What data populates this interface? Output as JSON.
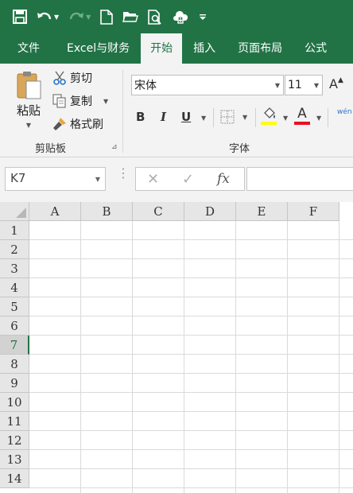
{
  "quick_access": {
    "save_icon": "save-icon",
    "undo_icon": "undo-icon",
    "redo_icon": "redo-icon",
    "new_icon": "new-document-icon",
    "open_icon": "open-folder-icon",
    "preview_icon": "print-preview-icon",
    "extra_icon": "cloud-sync-icon",
    "customize_icon": "customize-toolbar-icon"
  },
  "tabs": [
    {
      "label": "文件"
    },
    {
      "label": "Excel与财务"
    },
    {
      "label": "开始"
    },
    {
      "label": "插入"
    },
    {
      "label": "页面布局"
    },
    {
      "label": "公式"
    }
  ],
  "ribbon": {
    "clipboard": {
      "paste_label": "粘贴",
      "cut_label": "剪切",
      "copy_label": "复制",
      "format_painter_label": "格式刷",
      "group_label": "剪贴板"
    },
    "font": {
      "font_name": "宋体",
      "font_size": "11",
      "grow_icon_letter": "A",
      "bold_label": "B",
      "italic_label": "I",
      "underline_label": "U",
      "font_color_letter": "A",
      "phonetic_label": "wén",
      "group_label": "字体",
      "fill_color": "#ffff00",
      "font_color": "#e81123"
    }
  },
  "formula_bar": {
    "name_box": "K7",
    "cancel_glyph": "✕",
    "enter_glyph": "✓",
    "fx_label": "fx",
    "formula_value": ""
  },
  "grid": {
    "columns": [
      "A",
      "B",
      "C",
      "D",
      "E",
      "F"
    ],
    "rows": [
      "1",
      "2",
      "3",
      "4",
      "5",
      "6",
      "7",
      "8",
      "9",
      "10",
      "11",
      "12",
      "13",
      "14"
    ],
    "active_row": "7"
  },
  "colors": {
    "excel_green": "#217346",
    "ribbon_bg": "#f3f3f3"
  }
}
